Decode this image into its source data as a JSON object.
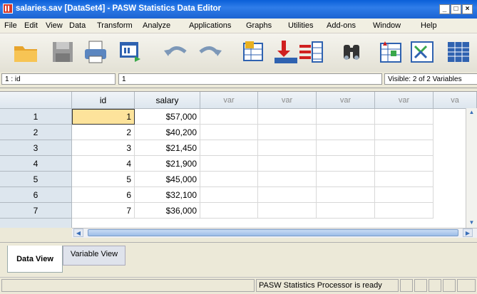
{
  "window": {
    "title": "salaries.sav [DataSet4] - PASW Statistics Data Editor",
    "minimize": "_",
    "maximize": "□",
    "close": "×"
  },
  "menu": [
    "File",
    "Edit",
    "View",
    "Data",
    "Transform",
    "Analyze",
    "Applications",
    "Graphs",
    "Utilities",
    "Add-ons",
    "Window",
    "Help"
  ],
  "toolbar": {
    "icons": [
      "open-folder-icon",
      "save-icon",
      "print-icon",
      "dialog-recall-icon",
      "undo-icon",
      "redo-icon",
      "goto-case-icon",
      "goto-variable-icon",
      "variables-icon",
      "find-icon",
      "insert-cases-icon",
      "split-file-icon",
      "value-labels-icon"
    ]
  },
  "editbar": {
    "cell_ref": "1 : id",
    "cell_value": "1",
    "visible": "Visible: 2 of 2 Variables"
  },
  "grid": {
    "columns": [
      "id",
      "salary",
      "var",
      "var",
      "var",
      "var",
      "va"
    ],
    "rows": [
      {
        "num": "1",
        "id": "1",
        "salary": "$57,000"
      },
      {
        "num": "2",
        "id": "2",
        "salary": "$40,200"
      },
      {
        "num": "3",
        "id": "3",
        "salary": "$21,450"
      },
      {
        "num": "4",
        "id": "4",
        "salary": "$21,900"
      },
      {
        "num": "5",
        "id": "5",
        "salary": "$45,000"
      },
      {
        "num": "6",
        "id": "6",
        "salary": "$32,100"
      },
      {
        "num": "7",
        "id": "7",
        "salary": "$36,000"
      }
    ]
  },
  "tabs": {
    "data_view": "Data View",
    "variable_view": "Variable View"
  },
  "status": {
    "processor": "PASW Statistics Processor is ready"
  }
}
